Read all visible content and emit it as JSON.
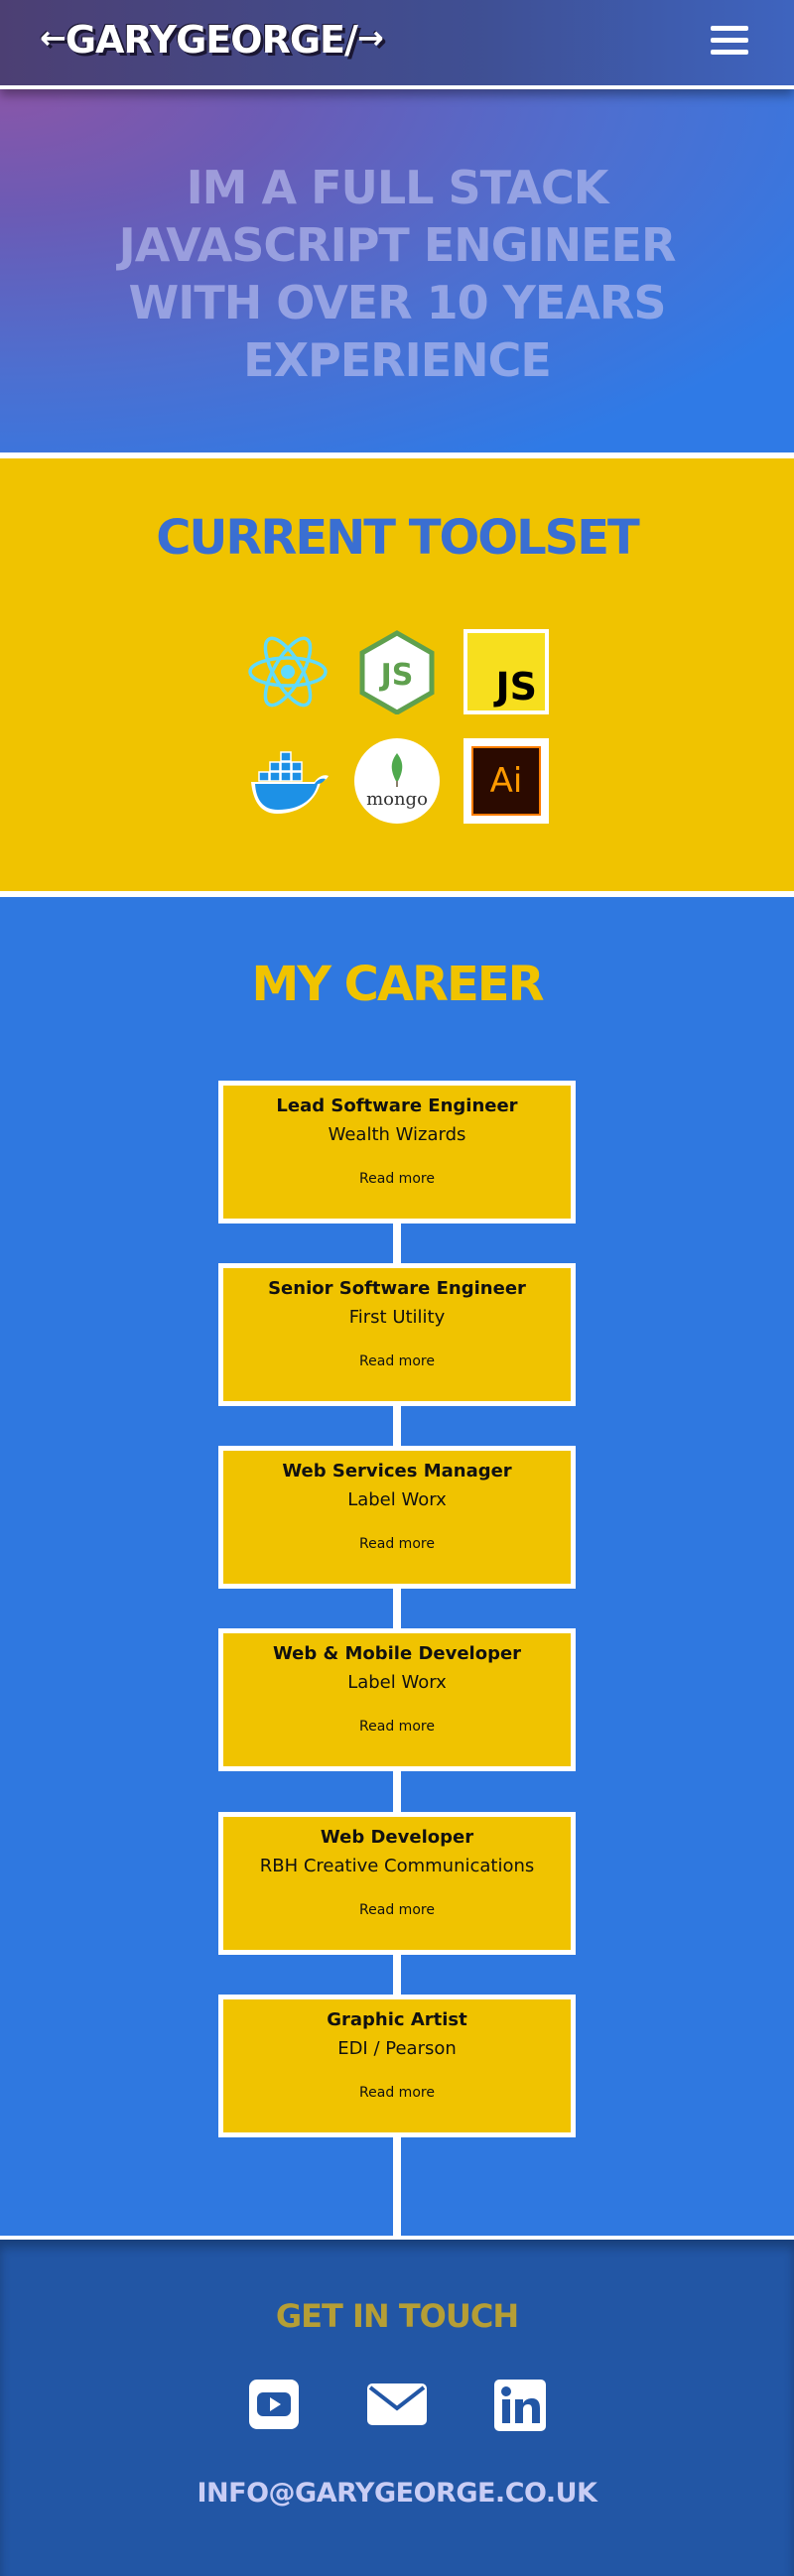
{
  "header": {
    "logo_text": "GARYGEORGE/",
    "logo_left_arrow": "←",
    "logo_right_arrow": "→"
  },
  "hero": {
    "headline": "IM A FULL STACK JAVASCRIPT ENGINEER WITH OVER 10 YEARS EXPERIENCE"
  },
  "toolset": {
    "title": "CURRENT TOOLSET",
    "tools": [
      "react-icon",
      "nodejs-icon",
      "javascript-icon",
      "docker-icon",
      "mongodb-icon",
      "illustrator-icon"
    ],
    "js_label": "JS",
    "mongo_label": "mongo",
    "ai_label": "Ai"
  },
  "career": {
    "title": "MY CAREER",
    "jobs": [
      {
        "role": "Lead Software Engineer",
        "company": "Wealth Wizards",
        "link": "Read more"
      },
      {
        "role": "Senior Software Engineer",
        "company": "First Utility",
        "link": "Read more"
      },
      {
        "role": "Web Services Manager",
        "company": "Label Worx",
        "link": "Read more"
      },
      {
        "role": "Web & Mobile Developer",
        "company": "Label Worx",
        "link": "Read more"
      },
      {
        "role": "Web Developer",
        "company": "RBH Creative Communications",
        "link": "Read more"
      },
      {
        "role": "Graphic Artist",
        "company": "EDI / Pearson",
        "link": "Read more"
      }
    ]
  },
  "contact": {
    "title": "GET IN TOUCH",
    "social": [
      "youtube-icon",
      "mail-icon",
      "linkedin-icon"
    ],
    "email": "INFO@GARYGEORGE.CO.UK"
  },
  "colors": {
    "yellow": "#f0c300",
    "blue": "#2f78e0",
    "footer_blue": "#2256a5",
    "white": "#ffffff"
  }
}
